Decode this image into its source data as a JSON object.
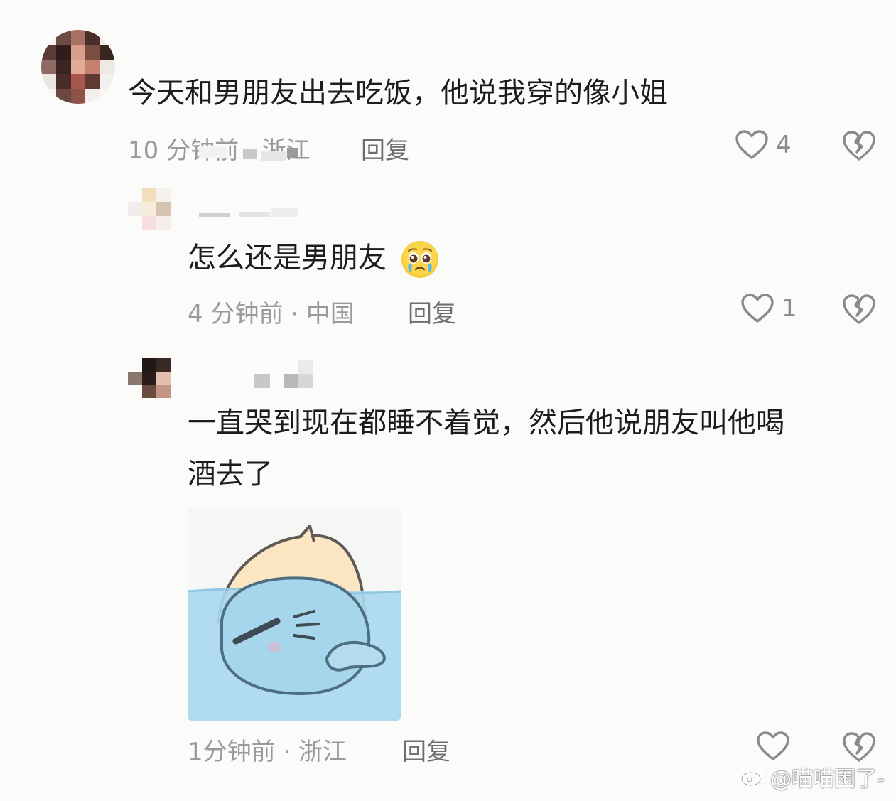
{
  "comments": [
    {
      "text": "今天和男朋友出去吃饭，他说我穿的像小姐",
      "time": "10 分钟前 · 浙江",
      "reply_label": "回复",
      "likes": "4"
    },
    {
      "text": "怎么还是男朋友",
      "emoji": "pleading-face-emoji",
      "time": "4 分钟前 · 中国",
      "reply_label": "回复",
      "likes": "1"
    },
    {
      "text_line1": "一直哭到现在都睡不着觉，然后他说朋友叫他喝",
      "text_line2": "酒去了",
      "sticker": "sleeping-bun-sticker",
      "time": "1分钟前 · 浙江",
      "reply_label": "回复",
      "likes": ""
    }
  ],
  "watermark": {
    "text": "@喵喵困了-",
    "icon": "weibo-icon"
  },
  "colors": {
    "background": "#fbfbf9",
    "text": "#1c1c1c",
    "meta": "#9a9a9a",
    "icon": "#8a8a8a"
  }
}
